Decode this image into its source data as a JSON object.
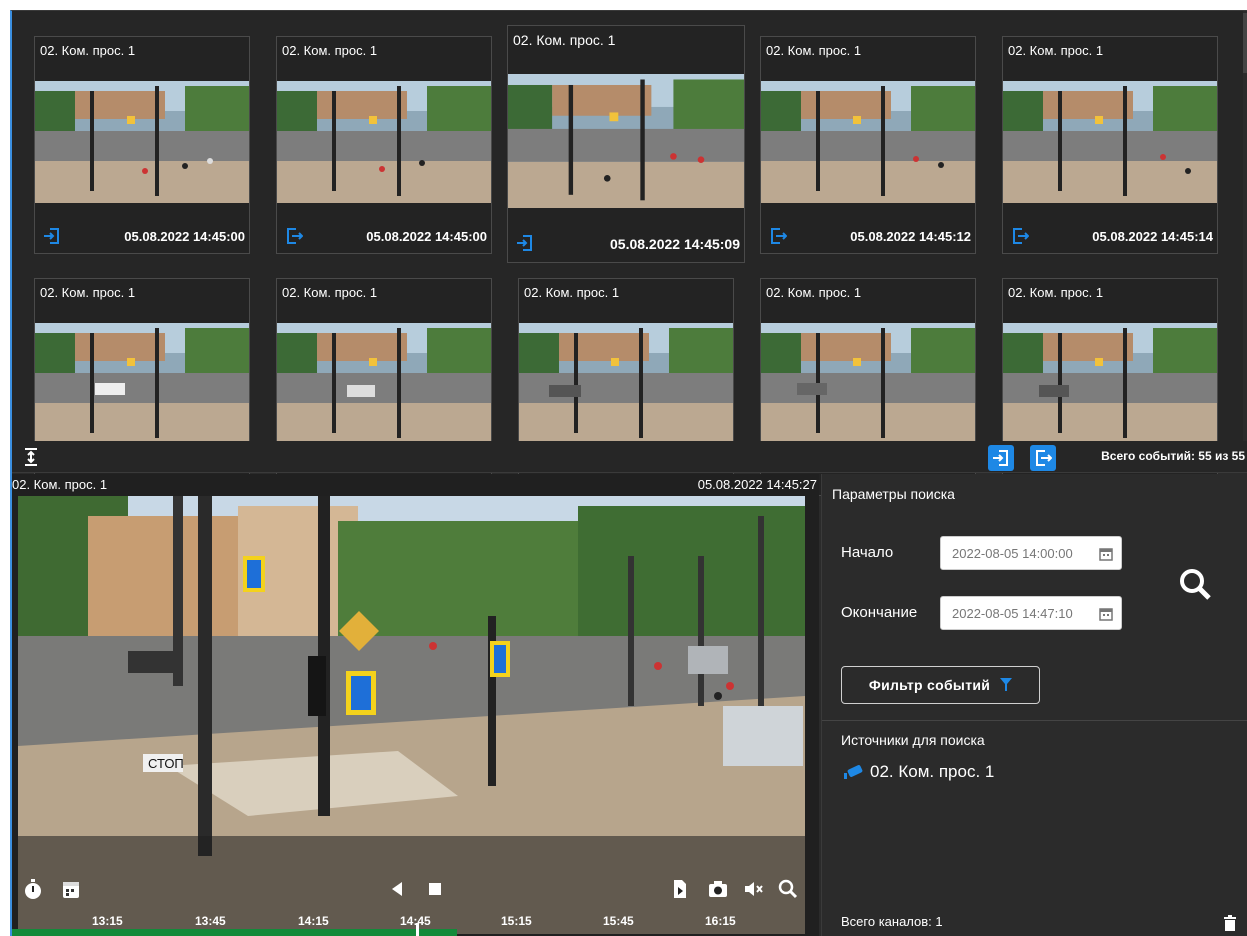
{
  "events": {
    "cards": [
      {
        "title": "02. Ком. прос. 1",
        "date": "05.08.2022 14:45:00",
        "type": "enter"
      },
      {
        "title": "02. Ком. прос. 1",
        "date": "05.08.2022 14:45:00",
        "type": "exit"
      },
      {
        "title": "02. Ком. прос. 1",
        "date": "05.08.2022 14:45:09",
        "type": "enter"
      },
      {
        "title": "02. Ком. прос. 1",
        "date": "05.08.2022 14:45:12",
        "type": "exit"
      },
      {
        "title": "02. Ком. прос. 1",
        "date": "05.08.2022 14:45:14",
        "type": "exit"
      },
      {
        "title": "02. Ком. прос. 1",
        "date": "",
        "type": ""
      },
      {
        "title": "02. Ком. прос. 1",
        "date": "",
        "type": ""
      },
      {
        "title": "02. Ком. прос. 1",
        "date": "",
        "type": ""
      },
      {
        "title": "02. Ком. прос. 1",
        "date": "",
        "type": ""
      },
      {
        "title": "02. Ком. прос. 1",
        "date": "",
        "type": ""
      }
    ],
    "total_label": "Всего событий: 55 из 55"
  },
  "player": {
    "title": "02. Ком. прос. 1",
    "date": "05.08.2022 14:45:27",
    "timeline": [
      "13:15",
      "13:45",
      "14:15",
      "14:45",
      "15:15",
      "15:45",
      "16:15"
    ],
    "overlay_text": "СТОП"
  },
  "panel": {
    "search_params_title": "Параметры поиска",
    "start_label": "Начало",
    "start_value": "2022-08-05 14:00:00",
    "end_label": "Окончание",
    "end_value": "2022-08-05 14:47:10",
    "filter_label": "Фильтр событий",
    "sources_title": "Источники для поиска",
    "source_name": "02. Ком. прос. 1",
    "total_channels": "Всего каналов: 1"
  },
  "colors": {
    "accent": "#1e88e5",
    "timeline_bar": "#138a3a",
    "background": "#2b2b2b"
  }
}
